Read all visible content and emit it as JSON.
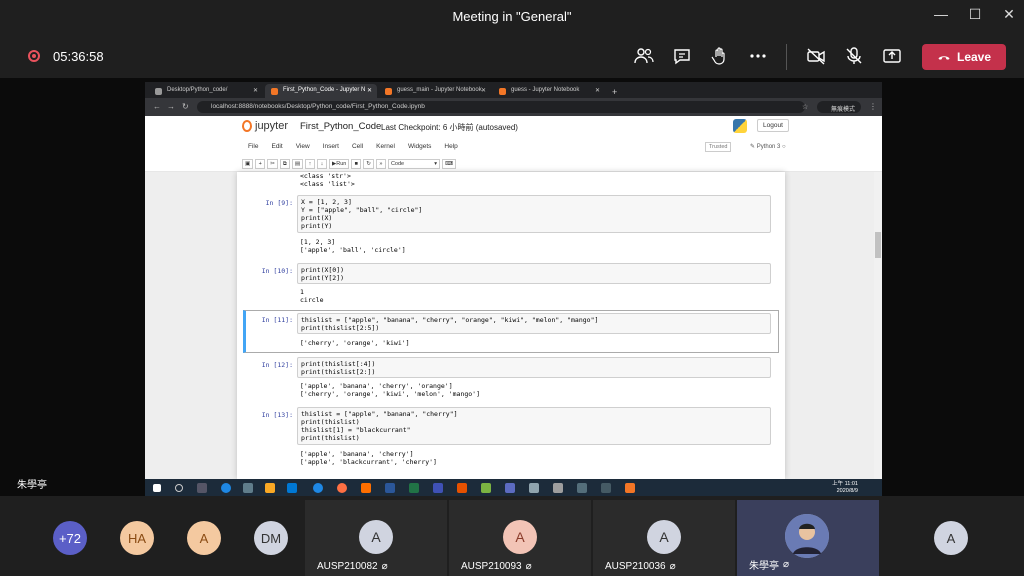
{
  "window": {
    "title": "Meeting in \"General\"",
    "controls": [
      "—",
      "☐",
      "✕"
    ]
  },
  "call": {
    "timer": "05:36:58",
    "leave_label": "Leave",
    "accent": "#c4314b"
  },
  "browser": {
    "tabs": [
      {
        "label": "Desktop/Python_code/",
        "active": false
      },
      {
        "label": "First_Python_Code - Jupyter N",
        "active": true
      },
      {
        "label": "guess_main - Jupyter Notebook",
        "active": false
      },
      {
        "label": "guess - Jupyter Notebook",
        "active": false
      }
    ],
    "url": "localhost:8888/notebooks/Desktop/Python_code/First_Python_Code.ipynb",
    "profile_label": "無痕模式"
  },
  "notebook": {
    "logo_text": "jupyter",
    "name": "First_Python_Code",
    "checkpoint": "Last Checkpoint: 6 小時前  (autosaved)",
    "logout_label": "Logout",
    "menu": [
      "File",
      "Edit",
      "View",
      "Insert",
      "Cell",
      "Kernel",
      "Widgets",
      "Help"
    ],
    "trusted_label": "Trusted",
    "kernel_label": "Python 3",
    "toolbar": {
      "run_label": "Run",
      "cell_type": "Code"
    },
    "prev_output": "<class 'str'>\n<class 'list'>",
    "cells": [
      {
        "prompt": "In [9]:",
        "code": "X = [1, 2, 3]\nY = [\"apple\", \"ball\", \"circle\"]\nprint(X)\nprint(Y)",
        "output": "[1, 2, 3]\n['apple', 'ball', 'circle']"
      },
      {
        "prompt": "In [10]:",
        "code": "print(X[0])\nprint(Y[2])",
        "output": "1\ncircle"
      },
      {
        "prompt": "In [11]:",
        "code": "thislist = [\"apple\", \"banana\", \"cherry\", \"orange\", \"kiwi\", \"melon\", \"mango\"]\nprint(thislist[2:5])",
        "output": "['cherry', 'orange', 'kiwi']",
        "selected": true
      },
      {
        "prompt": "In [12]:",
        "code": "print(thislist[:4])\nprint(thislist[2:])",
        "output": "['apple', 'banana', 'cherry', 'orange']\n['cherry', 'orange', 'kiwi', 'melon', 'mango']"
      },
      {
        "prompt": "In [13]:",
        "code": "thislist = [\"apple\", \"banana\", \"cherry\"]\nprint(thislist)\nthislist[1] = \"blackcurrant\"\nprint(thislist)",
        "output": "['apple', 'banana', 'cherry']\n['apple', 'blackcurrant', 'cherry']"
      }
    ]
  },
  "taskbar": {
    "time": "上午 11:01",
    "date": "2020/8/9"
  },
  "presenter_name": "朱學亭",
  "participants": {
    "overflow_count": "+72",
    "avatars": [
      {
        "initials": "HA",
        "color": "#f4c9a0"
      },
      {
        "initials": "A",
        "color": "#f4c9a0"
      },
      {
        "initials": "DM",
        "color": "#d0d4e0"
      }
    ],
    "tiles": [
      {
        "initials": "A",
        "name": "AUSP210082",
        "color": "#d0d4e0"
      },
      {
        "initials": "A",
        "name": "AUSP210093",
        "color": "#f2c4b6"
      },
      {
        "initials": "A",
        "name": "AUSP210036",
        "color": "#d0d4e0"
      },
      {
        "initials": "",
        "name": "朱學亭",
        "color": "#aab4d4"
      }
    ],
    "last_avatar": {
      "initials": "A",
      "color": "#d0d4e0"
    }
  }
}
